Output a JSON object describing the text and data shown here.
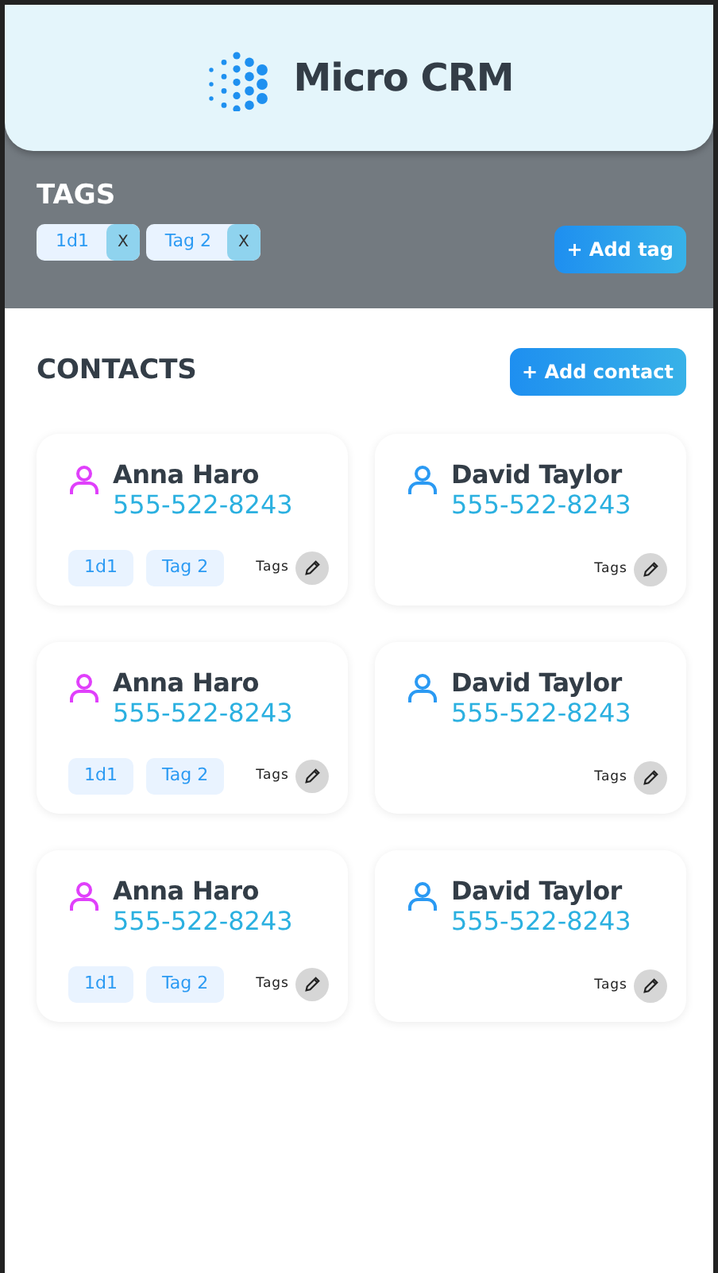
{
  "app": {
    "title": "Micro CRM"
  },
  "tags_section": {
    "title": "TAGS",
    "add_button": "+ Add tag",
    "tags": [
      {
        "label": "1d1",
        "remove_label": "X"
      },
      {
        "label": "Tag 2",
        "remove_label": "X"
      }
    ]
  },
  "contacts_section": {
    "title": "CONTACTS",
    "add_button": "+ Add contact",
    "contacts": [
      {
        "name": "Anna Haro",
        "phone": "555-522-8243",
        "color": "#e040fb",
        "tags": [
          "1d1",
          "Tag 2"
        ],
        "tags_label": "Tags"
      },
      {
        "name": "David Taylor",
        "phone": "555-522-8243",
        "color": "#2b9af3",
        "tags_label": "Tags"
      },
      {
        "name": "Anna Haro",
        "phone": "555-522-8243",
        "color": "#e040fb",
        "tags": [
          "1d1",
          "Tag 2"
        ],
        "tags_label": "Tags"
      },
      {
        "name": "David Taylor",
        "phone": "555-522-8243",
        "color": "#2b9af3",
        "tags_label": "Tags"
      },
      {
        "name": "Anna Haro",
        "phone": "555-522-8243",
        "color": "#e040fb",
        "tags": [
          "1d1",
          "Tag 2"
        ],
        "tags_label": "Tags"
      },
      {
        "name": "David Taylor",
        "phone": "555-522-8243",
        "color": "#2b9af3",
        "tags_label": "Tags"
      }
    ]
  }
}
